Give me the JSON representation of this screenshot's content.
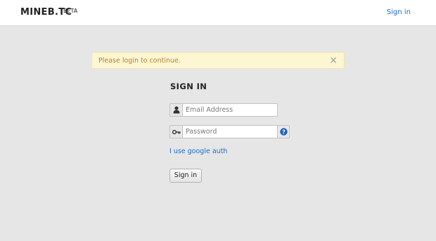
{
  "navbar": {
    "brand": "MINEB.TC",
    "badge": "BETA",
    "signin_link": "Sign in"
  },
  "alert": {
    "message": "Please login to continue.",
    "close_glyph": "×"
  },
  "form": {
    "title": "SIGN IN",
    "email_placeholder": "Email Address",
    "email_icon": "user-icon",
    "password_placeholder": "Password",
    "password_icon": "key-icon",
    "help_icon": "question-icon",
    "google_auth_link": "I use google auth",
    "submit_label": "Sign in"
  },
  "colors": {
    "link": "#1a6bc7",
    "alert_bg": "#fcf6d2",
    "alert_text": "#bd7e2f",
    "page_bg": "#e6e6e6",
    "help_icon": "#1f5fbf"
  }
}
